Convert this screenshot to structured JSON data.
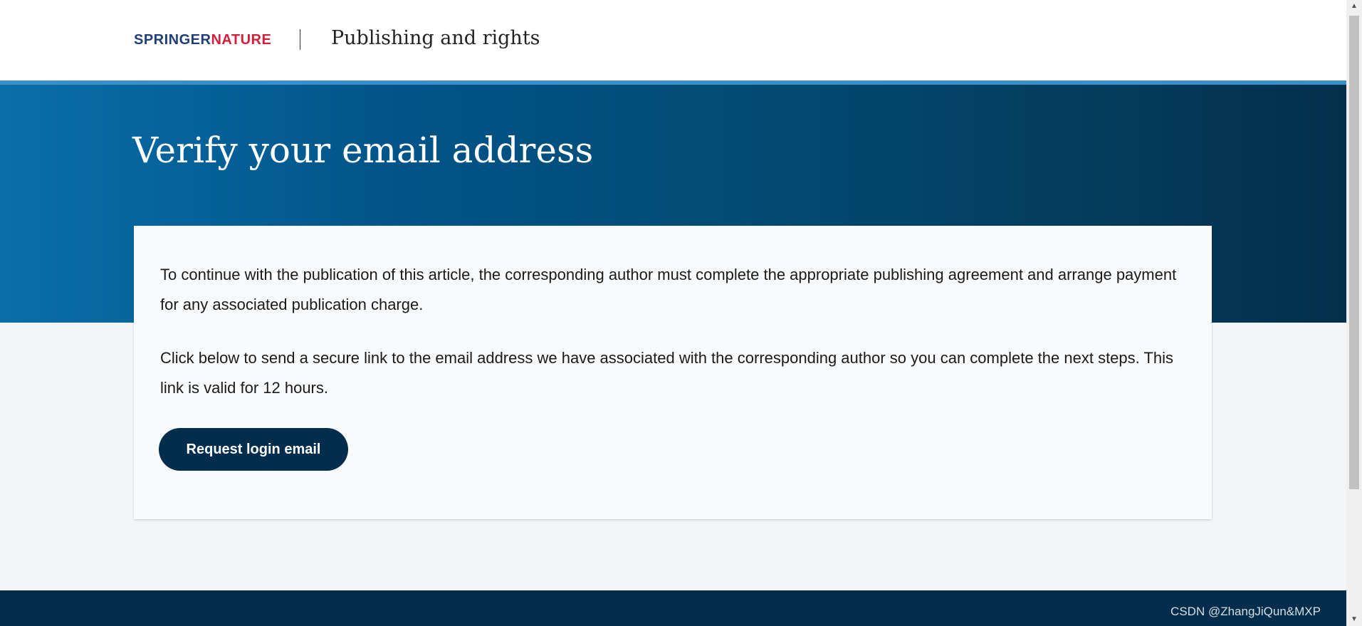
{
  "header": {
    "logo_part_a": "SPRINGER",
    "logo_part_b": "NATURE",
    "title": "Publishing and rights"
  },
  "hero": {
    "title": "Verify your email address"
  },
  "card": {
    "paragraph_1": "To continue with the publication of this article, the corresponding author must complete the appropriate publishing agreement and arrange payment for any associated publication charge.",
    "paragraph_2": "Click below to send a secure link to the email address we have associated with the corresponding author so you can complete the next steps. This link is valid for 12 hours.",
    "button_label": "Request login email"
  },
  "watermark": "CSDN @ZhangJiQun&MXP",
  "scrollbar": {
    "up_icon": "▲",
    "down_icon": "▼"
  },
  "colors": {
    "brand_navy": "#1f3f78",
    "brand_red": "#d31e3c",
    "accent_blue": "#3a8ec9",
    "button_bg": "#022d4c",
    "footer_bg": "#032d4a"
  }
}
